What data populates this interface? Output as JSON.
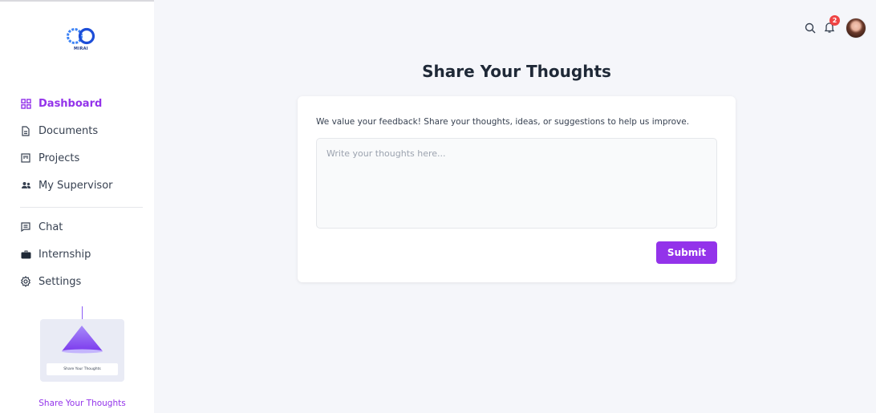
{
  "brand": {
    "logo_text": "MIRAI"
  },
  "sidebar": {
    "primary": [
      {
        "label": "Dashboard",
        "icon": "grid-icon",
        "active": true
      },
      {
        "label": "Documents",
        "icon": "document-icon"
      },
      {
        "label": "Projects",
        "icon": "kanban-icon"
      },
      {
        "label": "My Supervisor",
        "icon": "users-icon"
      }
    ],
    "secondary": [
      {
        "label": "Chat",
        "icon": "chat-icon"
      },
      {
        "label": "Internship",
        "icon": "briefcase-icon"
      },
      {
        "label": "Settings",
        "icon": "settings-icon"
      }
    ],
    "promo": {
      "card_label": "Share Your Thoughts",
      "link_label": "Share Your Thoughts"
    }
  },
  "topbar": {
    "notification_count": "2"
  },
  "main": {
    "title": "Share Your Thoughts",
    "description": "We value your feedback! Share your thoughts, ideas, or suggestions to help us improve.",
    "input_placeholder": "Write your thoughts here...",
    "submit_label": "Submit"
  },
  "colors": {
    "accent": "#9333ea",
    "background": "#f5f6fa",
    "badge": "#ef4444"
  }
}
